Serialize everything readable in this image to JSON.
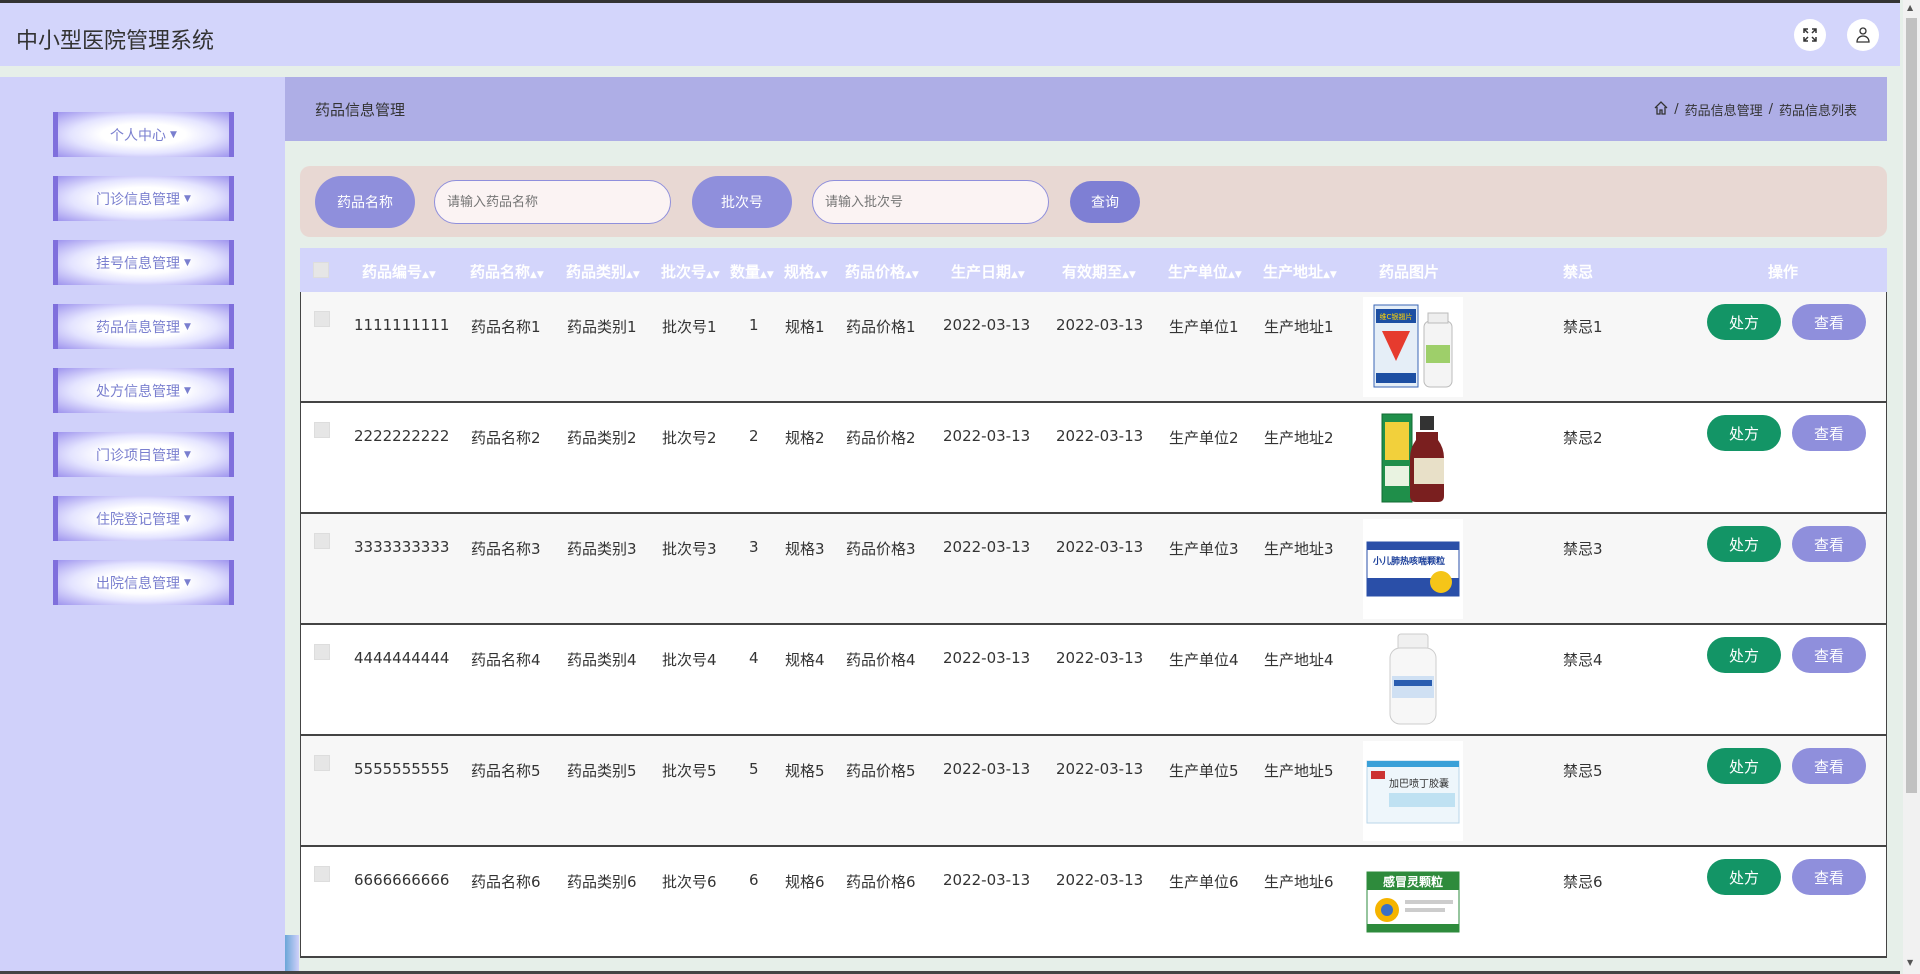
{
  "app": {
    "title": "中小型医院管理系统"
  },
  "topbar": {
    "expand_icon": "expand-icon",
    "user_icon": "user-icon"
  },
  "sidebar": {
    "items": [
      {
        "label": "个人中心"
      },
      {
        "label": "门诊信息管理"
      },
      {
        "label": "挂号信息管理"
      },
      {
        "label": "药品信息管理"
      },
      {
        "label": "处方信息管理"
      },
      {
        "label": "门诊项目管理"
      },
      {
        "label": "住院登记管理"
      },
      {
        "label": "出院信息管理"
      }
    ]
  },
  "header": {
    "title": "药品信息管理",
    "breadcrumb": [
      "药品信息管理",
      "药品信息列表"
    ]
  },
  "search": {
    "name_label": "药品名称",
    "name_placeholder": "请输入药品名称",
    "name_value": "",
    "batch_label": "批次号",
    "batch_placeholder": "请输入批次号",
    "batch_value": "",
    "query_label": "查询"
  },
  "table": {
    "columns": [
      "药品编号",
      "药品名称",
      "药品类别",
      "批次号",
      "数量",
      "规格",
      "药品价格",
      "生产日期",
      "有效期至",
      "生产单位",
      "生产地址",
      "药品图片",
      "禁忌",
      "操作"
    ],
    "rx_label": "处方",
    "view_label": "查看",
    "rows": [
      {
        "code": "1111111111",
        "name": "药品名称1",
        "category": "药品类别1",
        "batch": "批次号1",
        "qty": "1",
        "spec": "规格1",
        "price": "药品价格1",
        "mfg_date": "2022-03-13",
        "expiry": "2022-03-13",
        "maker": "生产单位1",
        "address": "生产地址1",
        "image_text": "维C银翘片",
        "taboo": "禁忌1"
      },
      {
        "code": "2222222222",
        "name": "药品名称2",
        "category": "药品类别2",
        "batch": "批次号2",
        "qty": "2",
        "spec": "规格2",
        "price": "药品价格2",
        "mfg_date": "2022-03-13",
        "expiry": "2022-03-13",
        "maker": "生产单位2",
        "address": "生产地址2",
        "image_text": "",
        "taboo": "禁忌2"
      },
      {
        "code": "3333333333",
        "name": "药品名称3",
        "category": "药品类别3",
        "batch": "批次号3",
        "qty": "3",
        "spec": "规格3",
        "price": "药品价格3",
        "mfg_date": "2022-03-13",
        "expiry": "2022-03-13",
        "maker": "生产单位3",
        "address": "生产地址3",
        "image_text": "小儿肺热咳喘颗粒",
        "taboo": "禁忌3"
      },
      {
        "code": "4444444444",
        "name": "药品名称4",
        "category": "药品类别4",
        "batch": "批次号4",
        "qty": "4",
        "spec": "规格4",
        "price": "药品价格4",
        "mfg_date": "2022-03-13",
        "expiry": "2022-03-13",
        "maker": "生产单位4",
        "address": "生产地址4",
        "image_text": "",
        "taboo": "禁忌4"
      },
      {
        "code": "5555555555",
        "name": "药品名称5",
        "category": "药品类别5",
        "batch": "批次号5",
        "qty": "5",
        "spec": "规格5",
        "price": "药品价格5",
        "mfg_date": "2022-03-13",
        "expiry": "2022-03-13",
        "maker": "生产单位5",
        "address": "生产地址5",
        "image_text": "加巴喷丁胶囊",
        "taboo": "禁忌5"
      },
      {
        "code": "6666666666",
        "name": "药品名称6",
        "category": "药品类别6",
        "batch": "批次号6",
        "qty": "6",
        "spec": "规格6",
        "price": "药品价格6",
        "mfg_date": "2022-03-13",
        "expiry": "2022-03-13",
        "maker": "生产单位6",
        "address": "生产地址6",
        "image_text": "感冒灵颗粒",
        "taboo": "禁忌6"
      }
    ]
  }
}
